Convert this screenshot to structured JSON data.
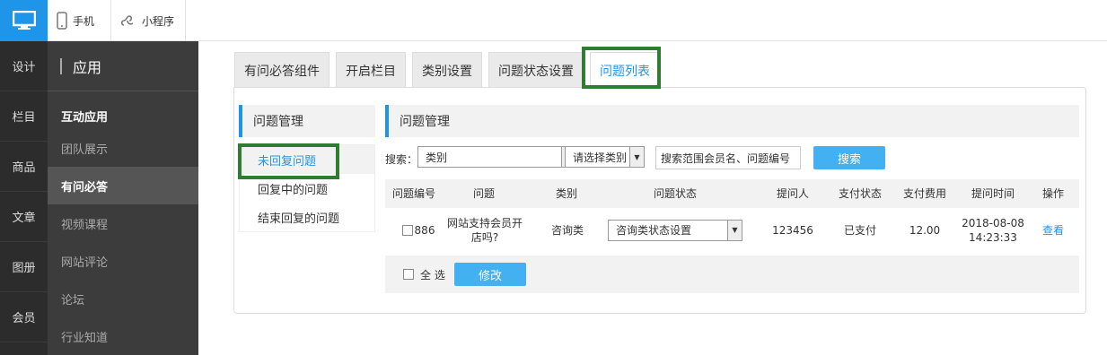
{
  "topbar": {
    "tabs": [
      {
        "label": "手机",
        "icon": "phone-icon"
      },
      {
        "label": "小程序",
        "icon": "mini-program-icon"
      }
    ]
  },
  "rail": [
    "设计",
    "栏目",
    "商品",
    "文章",
    "图册",
    "会员"
  ],
  "sidebar": {
    "title": "应用",
    "group": "互动应用",
    "items": [
      "团队展示",
      "有问必答",
      "视频课程",
      "网站评论",
      "论坛",
      "行业知道"
    ],
    "active": "有问必答"
  },
  "tabs": [
    "有问必答组件",
    "开启栏目",
    "类别设置",
    "问题状态设置",
    "问题列表"
  ],
  "active_tab": "问题列表",
  "left_nav": {
    "title": "问题管理",
    "items": [
      "未回复问题",
      "回复中的问题",
      "结束回复的问题"
    ]
  },
  "main": {
    "title": "问题管理",
    "search": {
      "label": "搜索：",
      "category_select": "类别",
      "type_select": "请选择类别",
      "input_value": "搜索范围会员名、问题编号",
      "button": "搜索"
    },
    "columns": [
      "问题编号",
      "问题",
      "类别",
      "问题状态",
      "提问人",
      "支付状态",
      "支付费用",
      "提问时间",
      "操作"
    ],
    "rows": [
      {
        "id": "886",
        "question_line1": "网站支持会员开",
        "question_line2": "店吗?",
        "category": "咨询类",
        "status_select": "咨询类状态设置",
        "asker": "123456",
        "pay_status": "已支付",
        "fee": "12.00",
        "date": "2018-08-08",
        "time": "14:23:33",
        "action": "查看"
      }
    ],
    "footer": {
      "select_all": "全 选",
      "modify_button": "修改"
    }
  },
  "colors": {
    "accent": "#1e95e8",
    "highlight": "#2e7d32",
    "button": "#43b0f2"
  }
}
